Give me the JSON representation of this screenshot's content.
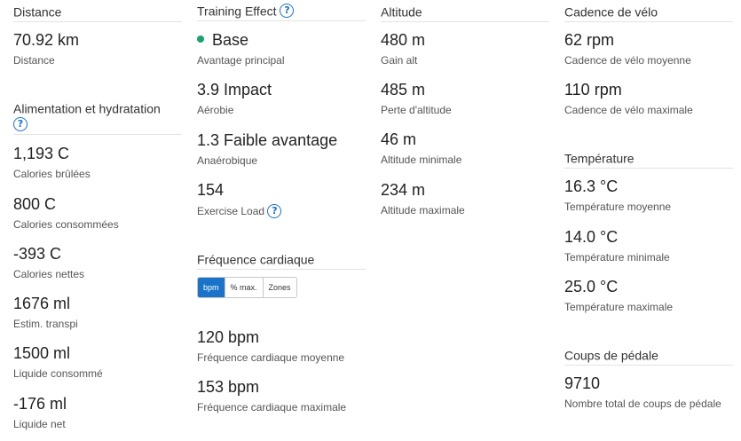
{
  "distance": {
    "title": "Distance",
    "items": [
      {
        "value": "70.92 km",
        "label": "Distance"
      }
    ]
  },
  "nutrition": {
    "title": "Alimentation et hydratation",
    "items": [
      {
        "value": "1,193 C",
        "label": "Calories brûlées"
      },
      {
        "value": "800 C",
        "label": "Calories consommées"
      },
      {
        "value": "-393 C",
        "label": "Calories nettes"
      },
      {
        "value": "1676 ml",
        "label": "Estim. transpi"
      },
      {
        "value": "1500 ml",
        "label": "Liquide consommé"
      },
      {
        "value": "-176 ml",
        "label": "Liquide net"
      }
    ]
  },
  "training_effect": {
    "title": "Training Effect",
    "items": [
      {
        "value": "Base",
        "label": "Avantage principal"
      },
      {
        "value": "3.9 Impact",
        "label": "Aérobie"
      },
      {
        "value": "1.3 Faible avantage",
        "label": "Anaérobique"
      },
      {
        "value": "154",
        "label": "Exercise Load"
      }
    ]
  },
  "heart_rate": {
    "title": "Fréquence cardiaque",
    "tabs": [
      {
        "label": "bpm"
      },
      {
        "label": "% max."
      },
      {
        "label": "Zones"
      }
    ],
    "items": [
      {
        "value": "120 bpm",
        "label": "Fréquence cardiaque moyenne"
      },
      {
        "value": "153 bpm",
        "label": "Fréquence cardiaque maximale"
      }
    ]
  },
  "altitude": {
    "title": "Altitude",
    "items": [
      {
        "value": "480 m",
        "label": "Gain alt"
      },
      {
        "value": "485 m",
        "label": "Perte d'altitude"
      },
      {
        "value": "46 m",
        "label": "Altitude minimale"
      },
      {
        "value": "234 m",
        "label": "Altitude maximale"
      }
    ]
  },
  "cadence": {
    "title": "Cadence de vélo",
    "items": [
      {
        "value": "62 rpm",
        "label": "Cadence de vélo moyenne"
      },
      {
        "value": "110 rpm",
        "label": "Cadence de vélo maximale"
      }
    ]
  },
  "temperature": {
    "title": "Température",
    "items": [
      {
        "value": "16.3 °C",
        "label": "Température moyenne"
      },
      {
        "value": "14.0 °C",
        "label": "Température minimale"
      },
      {
        "value": "25.0 °C",
        "label": "Température maximale"
      }
    ]
  },
  "pedal_strokes": {
    "title": "Coups de pédale",
    "items": [
      {
        "value": "9710",
        "label": "Nombre total de coups de pédale"
      }
    ]
  },
  "colors": {
    "accent": "#1a73c8",
    "base_dot": "#1aa36b"
  },
  "icons": {
    "help": "question-circle-icon",
    "status": "green-dot-icon"
  },
  "help_glyph": "?"
}
